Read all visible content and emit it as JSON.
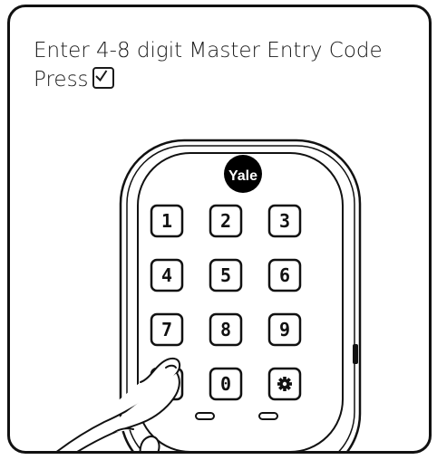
{
  "instructions": {
    "line1": "Enter 4-8 digit Master Entry Code",
    "line2": "Press"
  },
  "lock": {
    "brand": "Yale",
    "keys": [
      {
        "label": "1",
        "icon": ""
      },
      {
        "label": "2",
        "icon": ""
      },
      {
        "label": "3",
        "icon": ""
      },
      {
        "label": "4",
        "icon": ""
      },
      {
        "label": "5",
        "icon": ""
      },
      {
        "label": "6",
        "icon": ""
      },
      {
        "label": "7",
        "icon": ""
      },
      {
        "label": "8",
        "icon": ""
      },
      {
        "label": "9",
        "icon": ""
      },
      {
        "label": "",
        "icon": "check-icon"
      },
      {
        "label": "0",
        "icon": ""
      },
      {
        "label": "",
        "icon": "gear-icon"
      }
    ]
  },
  "colors": {
    "line": "#111111",
    "background": "#ffffff",
    "brand_badge": "#000000"
  }
}
